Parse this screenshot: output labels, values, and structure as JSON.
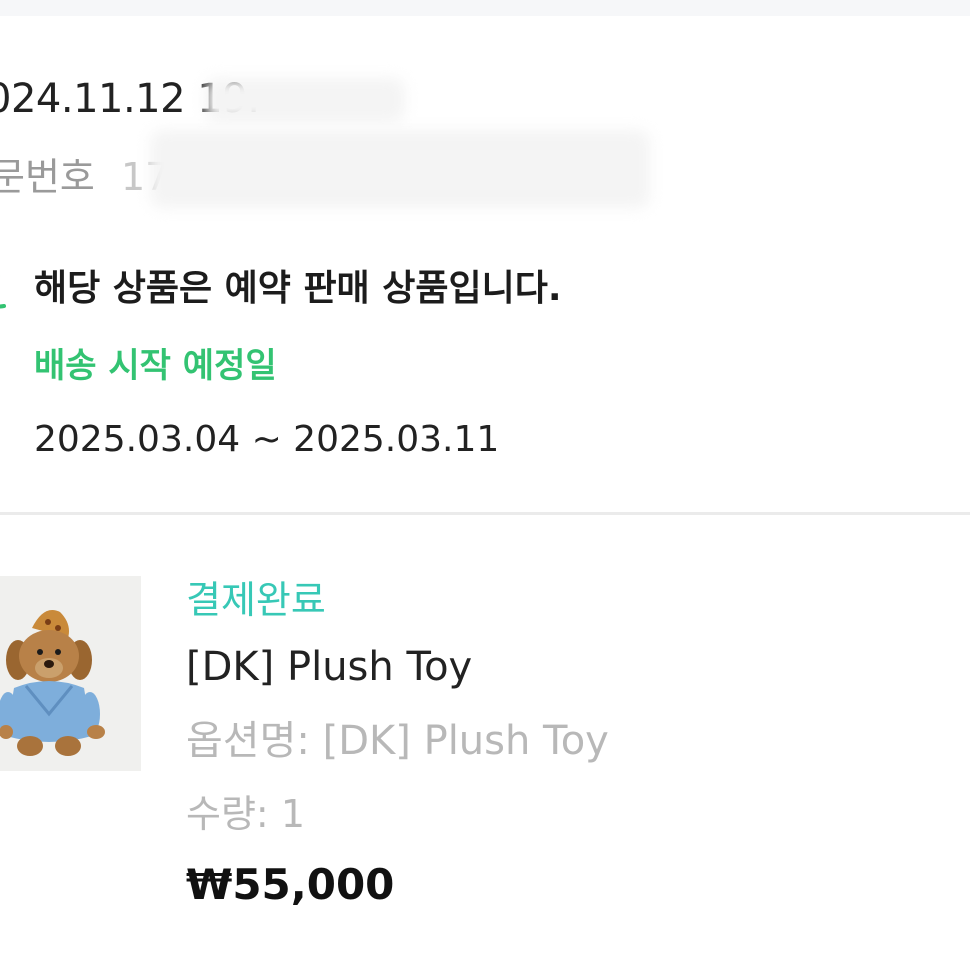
{
  "order": {
    "date_text": "024.11.12 19.",
    "number_label": "문번호",
    "number_value_partial": "17"
  },
  "preorder": {
    "title": "해당 상품은 예약 판매 상품입니다.",
    "ship_label": "배송 시작 예정일",
    "ship_range": "2025.03.04 ~ 2025.03.11"
  },
  "product": {
    "status": "결제완료",
    "name": "[DK] Plush Toy",
    "option_label": "옵션명:",
    "option_value": "[DK] Plush Toy",
    "qty_label": "수량:",
    "qty_value": "1",
    "price": "₩55,000"
  },
  "icons": {
    "preorder": "preorder-clock-icon",
    "thumbnail": "plush-toy-image"
  },
  "colors": {
    "accent_green": "#33c372",
    "status_teal": "#37c8b6",
    "muted_gray": "#b8b8b8",
    "divider": "#ebebeb"
  }
}
